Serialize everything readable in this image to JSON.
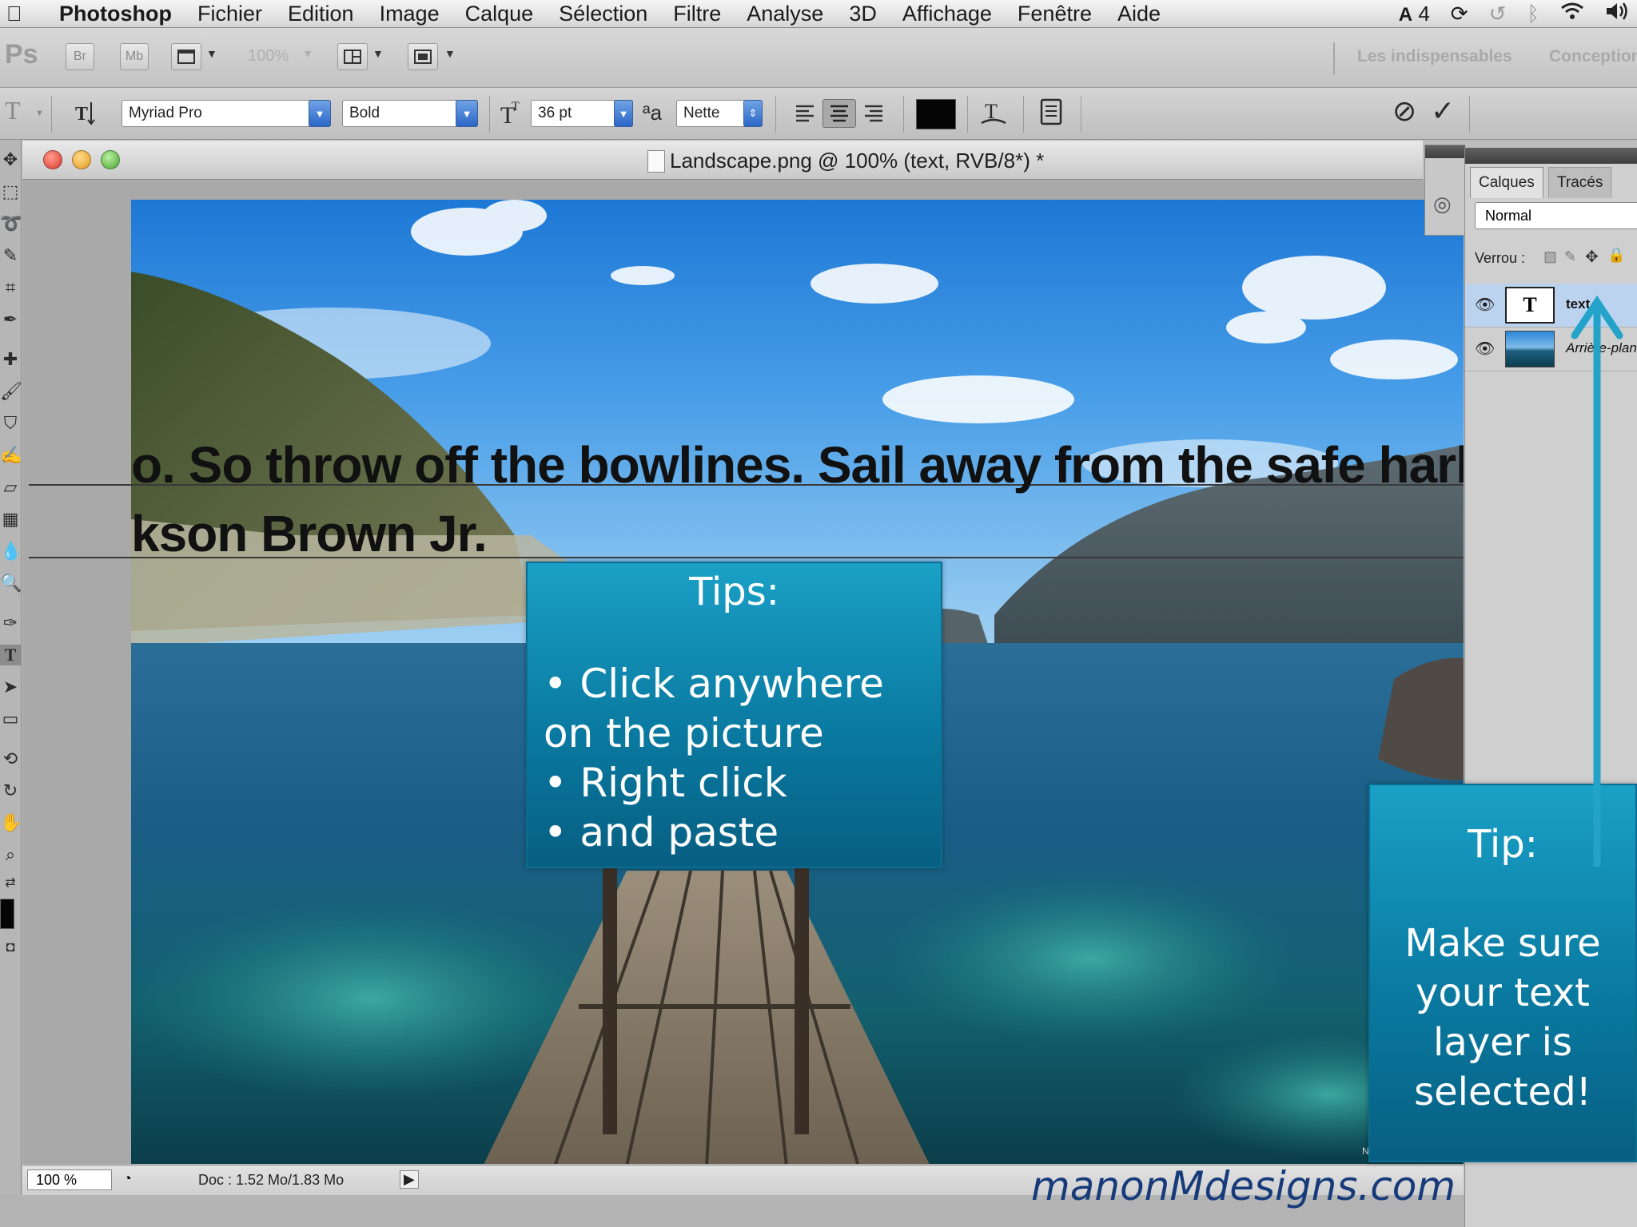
{
  "menubar": {
    "app_name": "Photoshop",
    "items": [
      "Fichier",
      "Edition",
      "Image",
      "Calque",
      "Sélection",
      "Filtre",
      "Analyse",
      "3D",
      "Affichage",
      "Fenêtre",
      "Aide"
    ],
    "status": {
      "adobe_badge": "4",
      "sync": "⟳",
      "time_machine": "↺",
      "bluetooth": "ᛒ",
      "wifi": "⌔",
      "volume": "🔈"
    }
  },
  "appbar": {
    "logo": "Ps",
    "bridge": "Br",
    "mini_bridge": "Mb",
    "zoom": "100%",
    "workspaces": [
      "Les indispensables",
      "Conception"
    ]
  },
  "options": {
    "tool_glyph": "T",
    "font_family": "Myriad Pro",
    "font_style": "Bold",
    "font_size": "36 pt",
    "antialias_label": "ªa",
    "antialias": "Nette",
    "text_color": "#050505",
    "cancel_glyph": "⊘",
    "commit_glyph": "✓"
  },
  "document": {
    "title": "Landscape.png @ 100% (text, RVB/8*) *",
    "text_line_1": "o. So throw off the bowlines. Sail away from the safe harb",
    "text_line_2": "kson Brown Jr.",
    "watermark": "NICKO"
  },
  "status": {
    "zoom": "100 %",
    "doc_size": "Doc : 1.52 Mo/1.83 Mo"
  },
  "layers_panel": {
    "tabs": [
      "Calques",
      "Tracés"
    ],
    "blend_mode": "Normal",
    "lock_label": "Verrou :",
    "layers": [
      {
        "name": "text",
        "visible": true,
        "selected": true,
        "type": "text"
      },
      {
        "name": "Arrière-plan",
        "visible": true,
        "selected": false,
        "type": "image"
      }
    ]
  },
  "tips": {
    "box1": {
      "title": "Tips:",
      "lines": [
        "• Click anywhere",
        "on the picture",
        "• Right click",
        "• and paste"
      ]
    },
    "box2": {
      "title": "Tip:",
      "lines": [
        "Make sure",
        "your text",
        "layer is",
        "selected!"
      ]
    }
  },
  "brand": "manonMdesigns.com",
  "colors": {
    "tip_fill": "#0a7aa1",
    "arrow": "#23a3c9",
    "brand_text": "#163a7a"
  }
}
